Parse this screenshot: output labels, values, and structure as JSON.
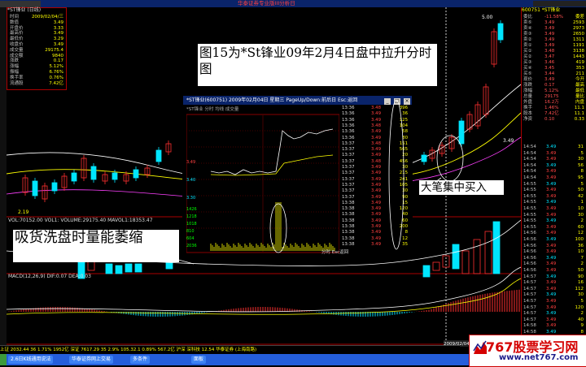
{
  "app": {
    "title": "华泰证券专业版III分析日",
    "stock_code_head": "600751 *ST锋业",
    "menu_stub": "锋业 日线"
  },
  "info_panel": {
    "header": "*ST锋业 (日线)",
    "rows": [
      {
        "k": "时间",
        "v": "2009/02/04/三"
      },
      {
        "k": "数值",
        "v": "3.49"
      },
      {
        "k": "开盘价",
        "v": "3.33"
      },
      {
        "k": "最高价",
        "v": "3.49"
      },
      {
        "k": "最低价",
        "v": "3.29"
      },
      {
        "k": "收盘价",
        "v": "3.49"
      },
      {
        "k": "成交量",
        "v": "29175.4"
      },
      {
        "k": "成交额",
        "v": "9840"
      },
      {
        "k": "涨跌",
        "v": "0.17"
      },
      {
        "k": "涨幅",
        "v": "5.12%"
      },
      {
        "k": "振幅",
        "v": "6.76%"
      },
      {
        "k": "换手率",
        "v": "0.76%"
      },
      {
        "k": "流通股",
        "v": "7.42亿"
      }
    ]
  },
  "chart": {
    "price_low": "2.19",
    "top_tick": "5.00",
    "right_tick": "3.49",
    "volume_header": "VOL:70152.00 VOL1: VOLUME:29175.40 MAVOL1:18353.47",
    "macd_header": "MACD(12,26,9) DIF:0.07 DEA:0.03",
    "date_label": "2009/02/04/三",
    "colors": {
      "up": "#ff3030",
      "down": "#00e5ff",
      "ma1": "#ffffff",
      "ma2": "#ffff00"
    }
  },
  "annotations": {
    "title": "图15为*St锋业09年2月4日盘中拉升分时图",
    "wash": "吸货洗盘时量能萎缩",
    "buy": "大笔集中买入"
  },
  "inset": {
    "title": "*ST锋业(600751) 2009年02月04日 星期三 PageUp/Down:前后日 Esc:返回",
    "sub": "*ST锋业  分时 均线 成交量",
    "bottom": "分时 Esc返回",
    "ylabels": [
      "3.49",
      "3.40",
      "3.30"
    ],
    "vol_labels": [
      "1426",
      "1218",
      "1018",
      "810",
      "604",
      "2036"
    ],
    "ticks": [
      {
        "t": "13:36",
        "p": "3.48",
        "v": "396"
      },
      {
        "t": "13:36",
        "p": "3.49",
        "v": "36"
      },
      {
        "t": "13:36",
        "p": "3.49",
        "v": "125"
      },
      {
        "t": "13:36",
        "p": "3.48",
        "v": "104"
      },
      {
        "t": "13:36",
        "p": "3.49",
        "v": "58"
      },
      {
        "t": "13:36",
        "p": "3.49",
        "v": "80"
      },
      {
        "t": "13:37",
        "p": "3.48",
        "v": "151"
      },
      {
        "t": "13:37",
        "p": "3.49",
        "v": "565"
      },
      {
        "t": "13:37",
        "p": "3.49",
        "v": "20"
      },
      {
        "t": "13:37",
        "p": "3.48",
        "v": "456"
      },
      {
        "t": "13:37",
        "p": "3.49",
        "v": "30"
      },
      {
        "t": "13:37",
        "p": "3.49",
        "v": "215"
      },
      {
        "t": "13:37",
        "p": "3.49",
        "v": "241"
      },
      {
        "t": "13:37",
        "p": "3.49",
        "v": "105"
      },
      {
        "t": "13:37",
        "p": "3.49",
        "v": "30"
      },
      {
        "t": "13:37",
        "p": "3.49",
        "v": "90"
      },
      {
        "t": "13:38",
        "p": "3.49",
        "v": "15"
      },
      {
        "t": "13:38",
        "p": "3.49",
        "v": "120"
      },
      {
        "t": "13:38",
        "p": "3.49",
        "v": "40"
      },
      {
        "t": "13:38",
        "p": "3.49",
        "v": "60"
      },
      {
        "t": "13:38",
        "p": "3.49",
        "v": "200"
      },
      {
        "t": "13:38",
        "p": "3.49",
        "v": "8"
      },
      {
        "t": "13:38",
        "p": "3.49",
        "v": "12"
      },
      {
        "t": "13:38",
        "p": "3.49",
        "v": "35"
      }
    ]
  },
  "right_panel": {
    "head": "600751 *ST锋业",
    "quote_rows": [
      {
        "l": "委比",
        "m": "-11.58%",
        "r": "委差"
      },
      {
        "l": "卖⑤",
        "m": "3.49",
        "r": "2593"
      },
      {
        "l": "卖④",
        "m": "3.49",
        "r": "2973"
      },
      {
        "l": "卖③",
        "m": "3.49",
        "r": "2650"
      },
      {
        "l": "卖②",
        "m": "3.49",
        "r": "1311"
      },
      {
        "l": "卖①",
        "m": "3.49",
        "r": "1191"
      },
      {
        "l": "买①",
        "m": "3.48",
        "r": "3138"
      },
      {
        "l": "买②",
        "m": "3.47",
        "r": "1443"
      },
      {
        "l": "买③",
        "m": "3.46",
        "r": "419"
      },
      {
        "l": "买④",
        "m": "3.45",
        "r": "353"
      },
      {
        "l": "买⑤",
        "m": "3.44",
        "r": "211"
      },
      {
        "l": "现价",
        "m": "3.49",
        "r": "今开"
      },
      {
        "l": "涨跌",
        "m": "0.17",
        "r": "最高"
      },
      {
        "l": "涨幅",
        "m": "5.12%",
        "r": "最低"
      },
      {
        "l": "总量",
        "m": "29175",
        "r": "量比"
      },
      {
        "l": "外盘",
        "m": "16.2万",
        "r": "内盘"
      },
      {
        "l": "换手",
        "m": "1.46%",
        "r": "11.1"
      },
      {
        "l": "股本",
        "m": "7.42亿",
        "r": "11.1"
      },
      {
        "l": "净资",
        "m": "0.10",
        "r": "0.33"
      }
    ],
    "ticks": [
      {
        "t": "14:54",
        "p": "3.49",
        "v": "31"
      },
      {
        "t": "14:54",
        "p": "3.49",
        "v": "5"
      },
      {
        "t": "14:54",
        "p": "3.49",
        "v": "30"
      },
      {
        "t": "14:54",
        "p": "3.49",
        "v": "56"
      },
      {
        "t": "14:54",
        "p": "3.49",
        "v": "8"
      },
      {
        "t": "14:54",
        "p": "3.49",
        "v": "95"
      },
      {
        "t": "14:55",
        "p": "3.49",
        "v": "5"
      },
      {
        "t": "14:55",
        "p": "3.49",
        "v": "50"
      },
      {
        "t": "14:55",
        "p": "3.49",
        "v": "42"
      },
      {
        "t": "14:55",
        "p": "3.49",
        "v": "1"
      },
      {
        "t": "14:55",
        "p": "3.49",
        "v": "10"
      },
      {
        "t": "14:55",
        "p": "3.49",
        "v": "30"
      },
      {
        "t": "14:55",
        "p": "3.49",
        "v": "2"
      },
      {
        "t": "14:55",
        "p": "3.49",
        "v": "60"
      },
      {
        "t": "14:56",
        "p": "3.49",
        "v": "12"
      },
      {
        "t": "14:56",
        "p": "3.49",
        "v": "100"
      },
      {
        "t": "14:56",
        "p": "3.49",
        "v": "36"
      },
      {
        "t": "14:56",
        "p": "3.49",
        "v": "10"
      },
      {
        "t": "14:56",
        "p": "3.49",
        "v": "7"
      },
      {
        "t": "14:56",
        "p": "3.49",
        "v": "2"
      },
      {
        "t": "14:56",
        "p": "3.49",
        "v": "50"
      },
      {
        "t": "14:57",
        "p": "3.49",
        "v": "90"
      },
      {
        "t": "14:57",
        "p": "3.49",
        "v": "16"
      },
      {
        "t": "14:57",
        "p": "3.49",
        "v": "112"
      },
      {
        "t": "14:57",
        "p": "3.49",
        "v": "30"
      },
      {
        "t": "14:57",
        "p": "3.49",
        "v": "5"
      },
      {
        "t": "14:57",
        "p": "3.49",
        "v": "120"
      },
      {
        "t": "14:57",
        "p": "3.49",
        "v": "2"
      },
      {
        "t": "14:57",
        "p": "3.49",
        "v": "40"
      },
      {
        "t": "14:58",
        "p": "3.49",
        "v": "9"
      },
      {
        "t": "14:58",
        "p": "3.49",
        "v": "8"
      }
    ]
  },
  "status": {
    "text": "上证 2032.44  36   1.71%  1952亿  深证 7617.29 35  2.9%  105.32.1 0.89%  567.2亿  沪深  深科技 12.54  华泰证券 (上海南路)"
  },
  "taskbar": {
    "items": [
      "2.6日K线通用说法",
      "华泰证券网上交易",
      "多条件",
      "面板"
    ]
  },
  "watermark": {
    "brand": "767股票学习网",
    "url": "www.net767.com"
  }
}
